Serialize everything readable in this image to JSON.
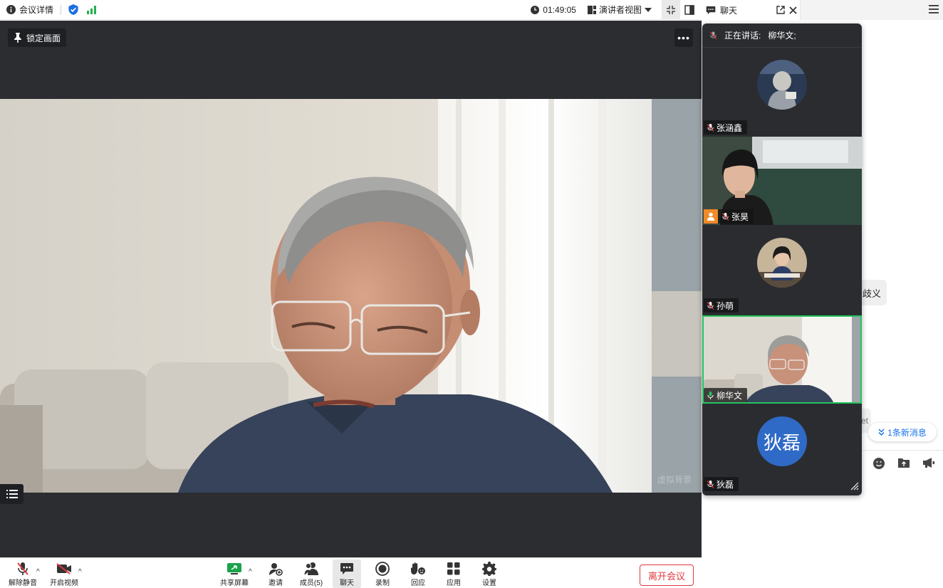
{
  "topbar": {
    "meeting_details": "会议详情",
    "timer": "01:49:05",
    "view_mode": "演讲者视图"
  },
  "stage": {
    "lock_label": "锁定画面",
    "more_label": "•••",
    "watermark": "虚拟背景"
  },
  "toolbar": {
    "unmute": "解除静音",
    "start_video": "开启视频",
    "share_screen": "共享屏幕",
    "invite": "邀请",
    "members": "成员(5)",
    "chat": "聊天",
    "record": "录制",
    "reactions": "回应",
    "apps": "应用",
    "settings": "设置",
    "leave": "离开会议"
  },
  "chat": {
    "title": "聊天",
    "bubble_partial": "歧义",
    "bubble_partial2": "et",
    "new_messages": "1条新消息"
  },
  "gallery": {
    "speaking_label": "正在讲话:",
    "speaker_name": "柳华文;",
    "participants": [
      {
        "name": "张涵鑫",
        "muted": true
      },
      {
        "name": "张昊",
        "muted": true,
        "host": true
      },
      {
        "name": "孙萌",
        "muted": true
      },
      {
        "name": "柳华文",
        "muted": false,
        "speaking": true
      },
      {
        "name": "狄磊",
        "muted": true,
        "avatar_text": "狄磊"
      }
    ]
  },
  "colors": {
    "accent_green": "#22c55e",
    "leave_red": "#e0383e",
    "avatar_blue": "#2f6ac6",
    "link_blue": "#1a73e8"
  }
}
